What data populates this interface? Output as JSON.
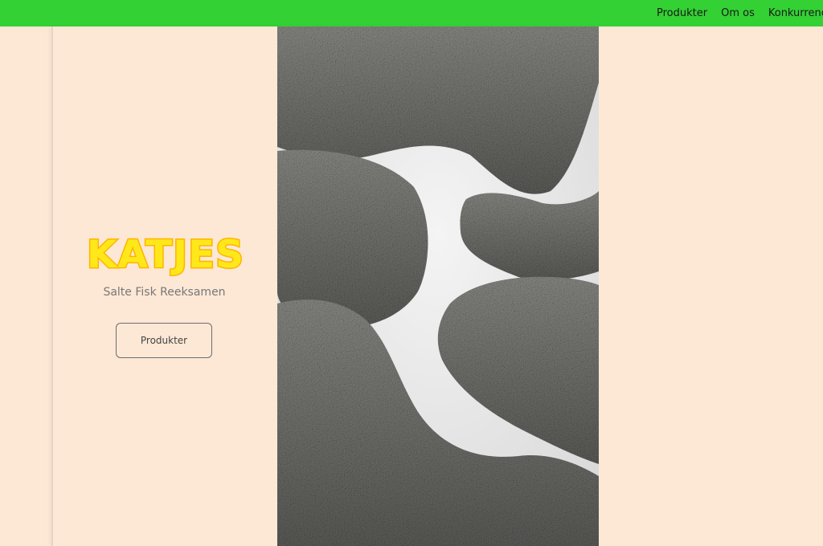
{
  "nav": {
    "items": [
      {
        "label": "Produkter"
      },
      {
        "label": "Om os"
      },
      {
        "label": "Konkurrence"
      }
    ]
  },
  "hero": {
    "brand": "KATJES",
    "subtitle": "Salte Fisk Reeksamen",
    "button_label": "Produkter",
    "image_alt": "salty-licorice-fish-photo"
  },
  "colors": {
    "nav_bg": "#33d133",
    "page_bg": "#fde8d6",
    "brand_fill": "#ffe81a",
    "brand_outline": "#ffb400"
  }
}
